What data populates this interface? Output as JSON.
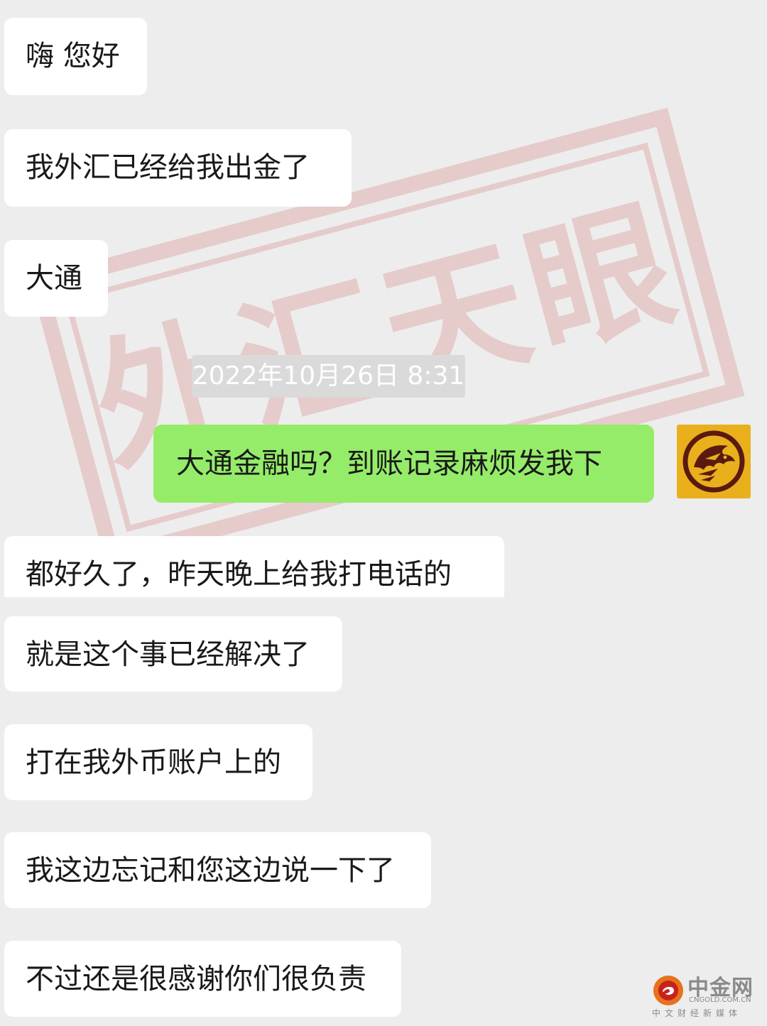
{
  "watermark": {
    "stamp_text": "外汇天眼",
    "site_name": "中金网",
    "site_url": "CNGOLD.COM.CN",
    "site_tagline": "中文财经新媒体",
    "colors": {
      "stamp": "#c41f1f",
      "logo_orange": "#e8711c",
      "logo_red": "#c8221c",
      "logo_text": "#8a8a8a"
    }
  },
  "chat": {
    "timestamp": "2022年10月26日 8:31",
    "messages": [
      {
        "direction": "incoming",
        "text": "嗨 您好"
      },
      {
        "direction": "incoming",
        "text": "我外汇已经给我出金了"
      },
      {
        "direction": "incoming",
        "text": "大通"
      },
      {
        "direction": "outgoing",
        "text": "大通金融吗？到账记录麻烦发我下",
        "avatar_icon": "eagle-logo-icon"
      },
      {
        "direction": "incoming",
        "text": "都好久了，昨天晚上给我打电话的"
      },
      {
        "direction": "incoming",
        "text": "就是这个事已经解决了"
      },
      {
        "direction": "incoming",
        "text": "打在我外币账户上的"
      },
      {
        "direction": "incoming",
        "text": "我这边忘记和您这边说一下了"
      },
      {
        "direction": "incoming",
        "text": "不过还是很感谢你们很负责"
      }
    ]
  },
  "colors": {
    "background": "#ededed",
    "incoming_bubble": "#ffffff",
    "outgoing_bubble": "#95ec69",
    "avatar_background": "#e9b01c",
    "avatar_eagle": "#5a1a10",
    "timestamp_background": "#dadada",
    "text": "#191919"
  }
}
